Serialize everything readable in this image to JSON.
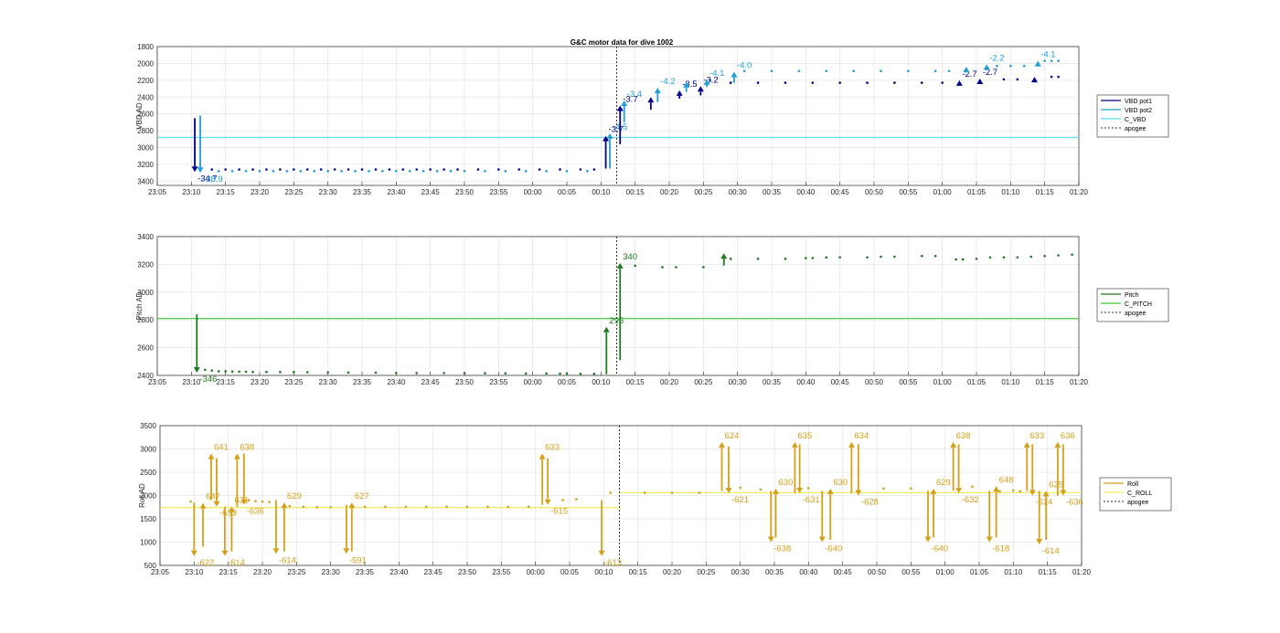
{
  "title": "G&C motor data for dive 1002",
  "colors": {
    "vbd_pot1": "#00008b",
    "vbd_pot2": "#1f9fd5",
    "c_vbd": "#5fdcec",
    "pitch": "#1f7a1f",
    "c_pitch": "#3cc83c",
    "roll": "#d4a017",
    "c_roll": "#f3ea5c",
    "apogee": "#333333",
    "grid": "#e6e6e6"
  },
  "x_tick_labels": [
    "23:05",
    "23:10",
    "23:15",
    "23:20",
    "23:25",
    "23:30",
    "23:35",
    "23:40",
    "23:45",
    "23:50",
    "23:55",
    "00:00",
    "00:05",
    "00:10",
    "00:15",
    "00:20",
    "00:25",
    "00:30",
    "00:35",
    "00:40",
    "00:45",
    "00:50",
    "00:55",
    "01:00",
    "01:05",
    "01:10",
    "01:15",
    "01:20"
  ],
  "chart_data": [
    {
      "type": "line",
      "name": "vbd",
      "title": "G&C motor data for dive 1002",
      "ylabel": "VBD AD",
      "xlim_minutes": [
        0,
        135
      ],
      "ylim": [
        1800,
        3450
      ],
      "y_reversed": true,
      "yticks": [
        "1800",
        "2000",
        "2200",
        "2400",
        "2600",
        "2800",
        "3000",
        "3200",
        "3400"
      ],
      "legend": [
        "VBD pot1",
        "VBD pot2",
        "C_VBD",
        "apogee"
      ],
      "legend_position": "outside-right",
      "grid": true,
      "reference_lines": [
        {
          "series": "C_VBD",
          "y": 2880
        },
        {
          "series": "apogee",
          "x_minutes": 67.3
        }
      ],
      "arrows": [
        {
          "series": "VBD pot1",
          "x": 5.5,
          "y0": 2650,
          "y1": 3290,
          "label": "-34.7"
        },
        {
          "series": "VBD pot2",
          "x": 6.3,
          "y0": 2620,
          "y1": 3300,
          "label": "-38.9"
        },
        {
          "series": "VBD pot1",
          "x": 65.7,
          "y0": 3250,
          "y1": 2860,
          "label": "-3.7"
        },
        {
          "series": "VBD pot2",
          "x": 66.3,
          "y0": 3250,
          "y1": 2830,
          "label": "-4.5"
        },
        {
          "series": "VBD pot1",
          "x": 67.8,
          "y0": 2960,
          "y1": 2500,
          "label": "-3.7"
        },
        {
          "series": "VBD pot2",
          "x": 68.4,
          "y0": 2700,
          "y1": 2440,
          "label": "-3.4"
        },
        {
          "series": "VBD pot1",
          "x": 72.3,
          "y0": 2550,
          "y1": 2400,
          "label": ""
        },
        {
          "series": "VBD pot2",
          "x": 73.3,
          "y0": 2460,
          "y1": 2290,
          "label": "-4.2"
        },
        {
          "series": "VBD pot1",
          "x": 76.5,
          "y0": 2420,
          "y1": 2320,
          "label": "-3.5"
        },
        {
          "series": "VBD pot2",
          "x": 77.5,
          "y0": 2340,
          "y1": 2220,
          "label": ""
        },
        {
          "series": "VBD pot1",
          "x": 79.6,
          "y0": 2380,
          "y1": 2270,
          "label": "-3.2"
        },
        {
          "series": "VBD pot2",
          "x": 80.5,
          "y0": 2280,
          "y1": 2190,
          "label": "-4.1"
        },
        {
          "series": "VBD pot2",
          "x": 84.5,
          "y0": 2230,
          "y1": 2100,
          "label": "-4.0"
        },
        {
          "series": "VBD pot1",
          "x": 117.5,
          "y0": 2240,
          "y1": 2200,
          "label": "-2.7"
        },
        {
          "series": "VBD pot2",
          "x": 118.5,
          "y0": 2090,
          "y1": 2040,
          "label": ""
        },
        {
          "series": "VBD pot1",
          "x": 120.5,
          "y0": 2220,
          "y1": 2180,
          "label": "-2.7"
        },
        {
          "series": "VBD pot2",
          "x": 121.5,
          "y0": 2050,
          "y1": 2010,
          "label": "-2.2"
        },
        {
          "series": "VBD pot1",
          "x": 128.5,
          "y0": 2200,
          "y1": 2160,
          "label": ""
        },
        {
          "series": "VBD pot2",
          "x": 129.0,
          "y0": 2020,
          "y1": 1970,
          "label": "-4.1"
        }
      ],
      "points_pot1": [
        [
          8,
          3260
        ],
        [
          10,
          3260
        ],
        [
          12,
          3260
        ],
        [
          14,
          3260
        ],
        [
          16,
          3260
        ],
        [
          18,
          3260
        ],
        [
          20,
          3260
        ],
        [
          22,
          3260
        ],
        [
          24,
          3260
        ],
        [
          26,
          3260
        ],
        [
          28,
          3260
        ],
        [
          30,
          3260
        ],
        [
          32,
          3260
        ],
        [
          34,
          3260
        ],
        [
          36,
          3260
        ],
        [
          38,
          3260
        ],
        [
          40,
          3260
        ],
        [
          42,
          3260
        ],
        [
          44,
          3260
        ],
        [
          47,
          3260
        ],
        [
          50,
          3260
        ],
        [
          53,
          3260
        ],
        [
          56,
          3260
        ],
        [
          59,
          3260
        ],
        [
          62,
          3260
        ],
        [
          64,
          3260
        ],
        [
          84,
          2230
        ],
        [
          88,
          2230
        ],
        [
          92,
          2230
        ],
        [
          96,
          2230
        ],
        [
          100,
          2230
        ],
        [
          104,
          2230
        ],
        [
          108,
          2230
        ],
        [
          112,
          2230
        ],
        [
          115,
          2230
        ],
        [
          124,
          2190
        ],
        [
          126,
          2190
        ],
        [
          131,
          2160
        ],
        [
          132,
          2160
        ]
      ],
      "points_pot2": [
        [
          9,
          3280
        ],
        [
          11,
          3280
        ],
        [
          13,
          3280
        ],
        [
          15,
          3280
        ],
        [
          17,
          3280
        ],
        [
          19,
          3280
        ],
        [
          21,
          3280
        ],
        [
          23,
          3280
        ],
        [
          25,
          3280
        ],
        [
          27,
          3280
        ],
        [
          29,
          3280
        ],
        [
          31,
          3280
        ],
        [
          33,
          3280
        ],
        [
          35,
          3280
        ],
        [
          37,
          3280
        ],
        [
          39,
          3280
        ],
        [
          41,
          3280
        ],
        [
          43,
          3280
        ],
        [
          45,
          3280
        ],
        [
          48,
          3280
        ],
        [
          51,
          3280
        ],
        [
          54,
          3280
        ],
        [
          57,
          3280
        ],
        [
          60,
          3280
        ],
        [
          63,
          3280
        ],
        [
          81,
          2200
        ],
        [
          86,
          2090
        ],
        [
          90,
          2090
        ],
        [
          94,
          2090
        ],
        [
          98,
          2090
        ],
        [
          102,
          2090
        ],
        [
          106,
          2090
        ],
        [
          110,
          2090
        ],
        [
          114,
          2090
        ],
        [
          116,
          2090
        ],
        [
          123,
          2030
        ],
        [
          125,
          2030
        ],
        [
          127,
          2030
        ],
        [
          130,
          1970
        ],
        [
          131,
          1970
        ],
        [
          132,
          1970
        ]
      ]
    },
    {
      "type": "line",
      "name": "pitch",
      "ylabel": "Pitch AD",
      "xlim_minutes": [
        0,
        135
      ],
      "ylim": [
        2400,
        3400
      ],
      "yticks": [
        "2400",
        "2600",
        "2800",
        "3000",
        "3200",
        "3400"
      ],
      "legend": [
        "Pitch",
        "C_PITCH",
        "apogee"
      ],
      "legend_position": "outside-right",
      "grid": true,
      "reference_lines": [
        {
          "series": "C_PITCH",
          "y": 2810
        },
        {
          "series": "apogee",
          "x_minutes": 67.3
        }
      ],
      "arrows": [
        {
          "series": "Pitch",
          "x": 5.8,
          "y0": 2840,
          "y1": 2420,
          "label": "-346"
        },
        {
          "series": "Pitch",
          "x": 65.8,
          "y0": 2410,
          "y1": 2750,
          "label": "296"
        },
        {
          "series": "Pitch",
          "x": 67.8,
          "y0": 2510,
          "y1": 3210,
          "label": "340"
        },
        {
          "series": "Pitch",
          "x": 83.0,
          "y0": 3190,
          "y1": 3280,
          "label": ""
        }
      ],
      "points": [
        [
          7,
          2440
        ],
        [
          8,
          2435
        ],
        [
          9,
          2430
        ],
        [
          10,
          2430
        ],
        [
          11,
          2428
        ],
        [
          12,
          2427
        ],
        [
          13,
          2426
        ],
        [
          14,
          2425
        ],
        [
          16,
          2425
        ],
        [
          18,
          2424
        ],
        [
          20,
          2424
        ],
        [
          22,
          2423
        ],
        [
          25,
          2422
        ],
        [
          28,
          2421
        ],
        [
          32,
          2420
        ],
        [
          35,
          2418
        ],
        [
          38,
          2417
        ],
        [
          42,
          2417
        ],
        [
          45,
          2416
        ],
        [
          48,
          2416
        ],
        [
          51,
          2415
        ],
        [
          54,
          2414
        ],
        [
          57,
          2414
        ],
        [
          59,
          2413
        ],
        [
          60,
          2413
        ],
        [
          62,
          2412
        ],
        [
          64,
          2412
        ],
        [
          70,
          3190
        ],
        [
          74,
          3180
        ],
        [
          76,
          3180
        ],
        [
          80,
          3180
        ],
        [
          84,
          3240
        ],
        [
          88,
          3240
        ],
        [
          92,
          3240
        ],
        [
          95,
          3245
        ],
        [
          96,
          3245
        ],
        [
          98,
          3250
        ],
        [
          100,
          3250
        ],
        [
          104,
          3250
        ],
        [
          106,
          3255
        ],
        [
          108,
          3255
        ],
        [
          112,
          3260
        ],
        [
          114,
          3260
        ],
        [
          117,
          3235
        ],
        [
          118,
          3235
        ],
        [
          120,
          3240
        ],
        [
          122,
          3250
        ],
        [
          124,
          3250
        ],
        [
          126,
          3250
        ],
        [
          128,
          3255
        ],
        [
          130,
          3260
        ],
        [
          132,
          3265
        ],
        [
          134,
          3270
        ]
      ]
    },
    {
      "type": "line",
      "name": "roll",
      "ylabel": "Roll AD",
      "xlim_minutes": [
        0,
        135
      ],
      "ylim": [
        500,
        3500
      ],
      "yticks": [
        "500",
        "1000",
        "1500",
        "2000",
        "2500",
        "3000",
        "3500"
      ],
      "legend": [
        "Roll",
        "C_ROLL",
        "apogee"
      ],
      "legend_position": "outside-right",
      "grid": true,
      "reference_lines": [
        {
          "series": "C_ROLL",
          "y": 1740,
          "x_end_minutes": 67.3
        },
        {
          "series": "C_ROLL",
          "y": 2060,
          "x_start_minutes": 67.3
        },
        {
          "series": "apogee",
          "x_minutes": 67.3
        }
      ],
      "arrows": [
        {
          "series": "Roll",
          "x": 5.0,
          "y0": 1850,
          "y1": 700,
          "label": "-622"
        },
        {
          "series": "Roll",
          "x": 6.3,
          "y0": 900,
          "y1": 1840,
          "label": "647"
        },
        {
          "series": "Roll",
          "x": 7.5,
          "y0": 1900,
          "y1": 2900,
          "label": "641"
        },
        {
          "series": "Roll",
          "x": 8.3,
          "y0": 2800,
          "y1": 1760,
          "label": "-633"
        },
        {
          "series": "Roll",
          "x": 9.5,
          "y0": 1760,
          "y1": 700,
          "label": "-614"
        },
        {
          "series": "Roll",
          "x": 10.5,
          "y0": 800,
          "y1": 1760,
          "label": "631"
        },
        {
          "series": "Roll",
          "x": 11.3,
          "y0": 1760,
          "y1": 2900,
          "label": "638"
        },
        {
          "series": "Roll",
          "x": 12.3,
          "y0": 2900,
          "y1": 1800,
          "label": "-636"
        },
        {
          "series": "Roll",
          "x": 17.0,
          "y0": 1900,
          "y1": 750,
          "label": "-614"
        },
        {
          "series": "Roll",
          "x": 18.2,
          "y0": 800,
          "y1": 1850,
          "label": "629"
        },
        {
          "series": "Roll",
          "x": 27.3,
          "y0": 1800,
          "y1": 750,
          "label": "-591"
        },
        {
          "series": "Roll",
          "x": 28.1,
          "y0": 800,
          "y1": 1850,
          "label": "627"
        },
        {
          "series": "Roll",
          "x": 56.0,
          "y0": 1800,
          "y1": 2900,
          "label": "633"
        },
        {
          "series": "Roll",
          "x": 56.8,
          "y0": 2800,
          "y1": 1800,
          "label": "-615"
        },
        {
          "series": "Roll",
          "x": 64.7,
          "y0": 1900,
          "y1": 700,
          "label": "-613"
        },
        {
          "series": "Roll",
          "x": 82.3,
          "y0": 2100,
          "y1": 3150,
          "label": "624"
        },
        {
          "series": "Roll",
          "x": 83.3,
          "y0": 3050,
          "y1": 2050,
          "label": "-621"
        },
        {
          "series": "Roll",
          "x": 89.5,
          "y0": 2100,
          "y1": 1000,
          "label": "-638"
        },
        {
          "series": "Roll",
          "x": 90.2,
          "y0": 1100,
          "y1": 2150,
          "label": "630"
        },
        {
          "series": "Roll",
          "x": 93.0,
          "y0": 2050,
          "y1": 3150,
          "label": "635"
        },
        {
          "series": "Roll",
          "x": 93.7,
          "y0": 3100,
          "y1": 2050,
          "label": "-631"
        },
        {
          "series": "Roll",
          "x": 97.0,
          "y0": 2100,
          "y1": 1000,
          "label": "-640"
        },
        {
          "series": "Roll",
          "x": 98.2,
          "y0": 1050,
          "y1": 2150,
          "label": "630"
        },
        {
          "series": "Roll",
          "x": 101.3,
          "y0": 2050,
          "y1": 3150,
          "label": "634"
        },
        {
          "series": "Roll",
          "x": 102.3,
          "y0": 3100,
          "y1": 2000,
          "label": "-628"
        },
        {
          "series": "Roll",
          "x": 112.5,
          "y0": 2100,
          "y1": 1000,
          "label": "-640"
        },
        {
          "series": "Roll",
          "x": 113.3,
          "y0": 1100,
          "y1": 2150,
          "label": "629"
        },
        {
          "series": "Roll",
          "x": 116.2,
          "y0": 2100,
          "y1": 3150,
          "label": "638"
        },
        {
          "series": "Roll",
          "x": 117.0,
          "y0": 3100,
          "y1": 2050,
          "label": "-632"
        },
        {
          "series": "Roll",
          "x": 121.5,
          "y0": 2100,
          "y1": 1000,
          "label": "-618"
        },
        {
          "series": "Roll",
          "x": 122.5,
          "y0": 1100,
          "y1": 2200,
          "label": "648"
        },
        {
          "series": "Roll",
          "x": 127.0,
          "y0": 2100,
          "y1": 3150,
          "label": "633"
        },
        {
          "series": "Roll",
          "x": 127.8,
          "y0": 3100,
          "y1": 2000,
          "label": "-624"
        },
        {
          "series": "Roll",
          "x": 128.8,
          "y0": 2100,
          "y1": 950,
          "label": "-614"
        },
        {
          "series": "Roll",
          "x": 129.8,
          "y0": 1050,
          "y1": 2100,
          "label": "625"
        },
        {
          "series": "Roll",
          "x": 131.5,
          "y0": 2000,
          "y1": 3150,
          "label": "636"
        },
        {
          "series": "Roll",
          "x": 132.3,
          "y0": 3100,
          "y1": 2000,
          "label": "-636"
        }
      ],
      "points": [
        [
          4.5,
          1870
        ],
        [
          13,
          1900
        ],
        [
          14,
          1880
        ],
        [
          15,
          1870
        ],
        [
          16,
          1860
        ],
        [
          19,
          1770
        ],
        [
          21,
          1760
        ],
        [
          23,
          1750
        ],
        [
          25,
          1750
        ],
        [
          30,
          1760
        ],
        [
          33,
          1760
        ],
        [
          36,
          1760
        ],
        [
          39,
          1760
        ],
        [
          42,
          1760
        ],
        [
          45,
          1760
        ],
        [
          48,
          1760
        ],
        [
          51,
          1760
        ],
        [
          54,
          1760
        ],
        [
          59,
          1900
        ],
        [
          61,
          1920
        ],
        [
          66,
          2060
        ],
        [
          71,
          2060
        ],
        [
          75,
          2060
        ],
        [
          79,
          2060
        ],
        [
          85,
          2170
        ],
        [
          88,
          2130
        ],
        [
          95,
          2160
        ],
        [
          106,
          2150
        ],
        [
          110,
          2150
        ],
        [
          119,
          2190
        ],
        [
          123,
          2090
        ],
        [
          125,
          2110
        ],
        [
          126,
          2090
        ]
      ]
    }
  ]
}
